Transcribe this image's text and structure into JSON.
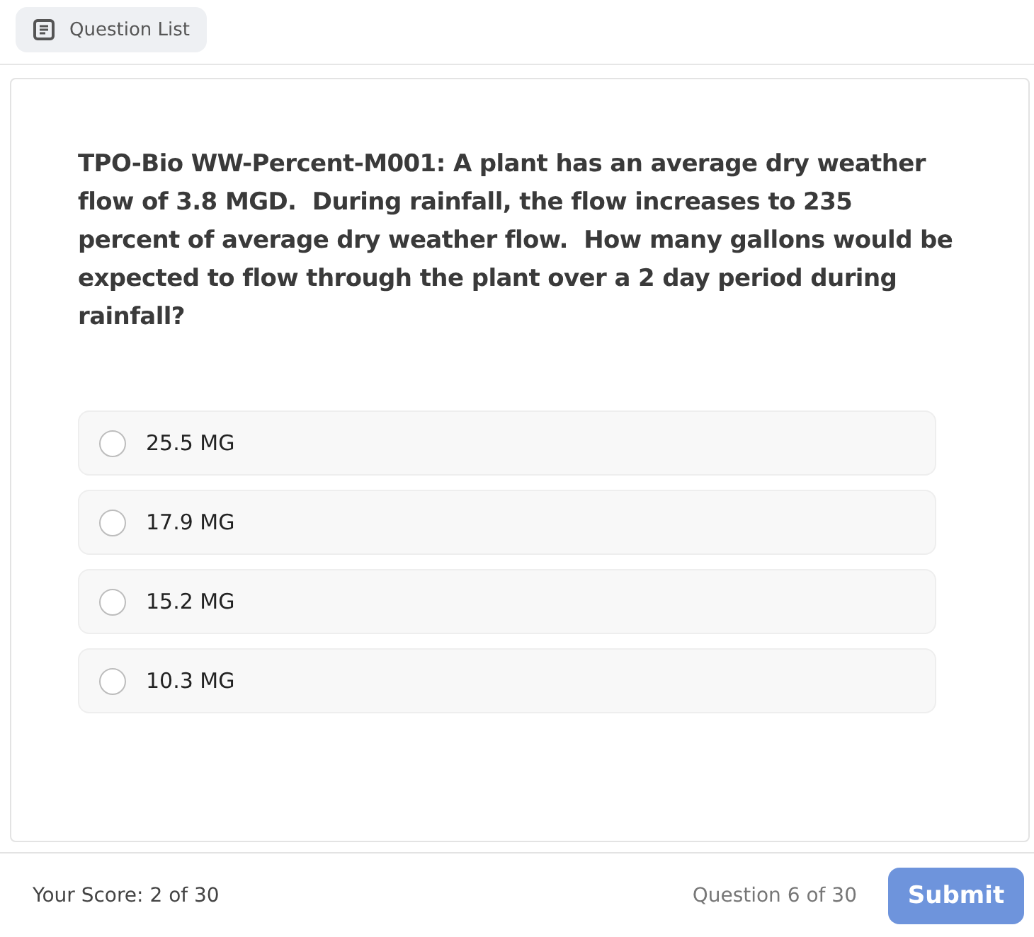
{
  "header": {
    "question_list_button": "Question List"
  },
  "question": {
    "text": "TPO-Bio WW-Percent-M001: A plant has an average dry weather flow of 3.8 MGD.  During rainfall, the flow increases to 235 percent of average dry weather flow.  How many gallons would be expected to flow through the plant over a 2 day period during rainfall?",
    "options": [
      {
        "label": "25.5 MG",
        "selected": false
      },
      {
        "label": "17.9 MG",
        "selected": false
      },
      {
        "label": "15.2 MG",
        "selected": false
      },
      {
        "label": "10.3 MG",
        "selected": false
      }
    ]
  },
  "footer": {
    "score": "Your Score: 2 of 30",
    "progress": "Question 6 of 30",
    "submit": {
      "label": "Submit",
      "disabled": true
    }
  }
}
